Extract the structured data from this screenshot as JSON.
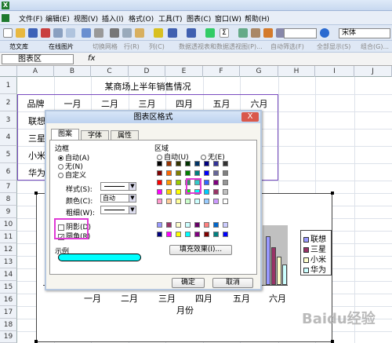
{
  "menubar": {
    "items": [
      "文件(F)",
      "编辑(E)",
      "视图(V)",
      "插入(I)",
      "格式(O)",
      "工具(T)",
      "图表(C)",
      "窗口(W)",
      "帮助(H)"
    ]
  },
  "toolbar": {
    "font_name": "宋体",
    "row2_items": [
      "范文库",
      "在线图片",
      "切换网格",
      "行(R)",
      "列(C)",
      "数据透视表和数据透视图(P)...",
      "自动筛选(F)",
      "全部显示(S)",
      "组合(G)..."
    ]
  },
  "formulabar": {
    "name_box": "图表区",
    "fx": "fx"
  },
  "columns": [
    "A",
    "B",
    "C",
    "D",
    "E",
    "F",
    "G",
    "H",
    "I",
    "J"
  ],
  "rows": [
    "1",
    "2",
    "3",
    "4",
    "5",
    "6",
    "7",
    "8",
    "9",
    "10",
    "11",
    "12",
    "13",
    "14",
    "15",
    "16",
    "17",
    "18",
    "19"
  ],
  "sheet": {
    "title": "某商场上半年销售情况",
    "header_row": [
      "品牌",
      "一月",
      "二月",
      "三月",
      "四月",
      "五月",
      "六月"
    ],
    "brands": [
      "联想",
      "三星",
      "小米",
      "华为"
    ]
  },
  "chart": {
    "x_labels": [
      "一月",
      "二月",
      "三月",
      "四月",
      "五月",
      "六月"
    ],
    "x_title": "月份",
    "legend": [
      "联想",
      "三星",
      "小米",
      "华为"
    ],
    "colors": [
      "#9999ff",
      "#993366",
      "#ffffcc",
      "#ccffff"
    ]
  },
  "chart_data": {
    "type": "bar",
    "categories": [
      "一月",
      "二月",
      "三月",
      "四月",
      "五月",
      "六月"
    ],
    "series": [
      {
        "name": "联想",
        "values": []
      },
      {
        "name": "三星",
        "values": []
      },
      {
        "name": "小米",
        "values": []
      },
      {
        "name": "华为",
        "values": []
      }
    ],
    "title": "",
    "xlabel": "月份",
    "ylabel": "",
    "legend_position": "right"
  },
  "dialog": {
    "title": "图表区格式",
    "close": "X",
    "tabs": [
      "图案",
      "字体",
      "属性"
    ],
    "border": {
      "group_label": "边框",
      "options": [
        "自动(A)",
        "无(N)",
        "自定义"
      ],
      "style_label": "样式(S):",
      "color_label": "颜色(C):",
      "color_value": "自动",
      "weight_label": "粗细(W):",
      "shadow_label": "阴影(D)",
      "round_label": "圆角(R)",
      "sample_label": "示例"
    },
    "area": {
      "group_label": "区域",
      "auto_option": "自动(U)",
      "none_option": "无(E)",
      "fill_effects": "填充效果(I)..."
    },
    "ok": "确定",
    "cancel": "取消",
    "palette": [
      "#000000",
      "#993300",
      "#333300",
      "#003300",
      "#003366",
      "#000080",
      "#333399",
      "#333333",
      "#800000",
      "#ff6600",
      "#808000",
      "#008000",
      "#008080",
      "#0000ff",
      "#666699",
      "#808080",
      "#ff0000",
      "#ff9900",
      "#99cc00",
      "#339966",
      "#33cccc",
      "#3366ff",
      "#800080",
      "#969696",
      "#ff00ff",
      "#ffcc00",
      "#ffff00",
      "#00ff00",
      "#00ffff",
      "#00ccff",
      "#993366",
      "#c0c0c0",
      "#ff99cc",
      "#ffcc99",
      "#ffff99",
      "#ccffcc",
      "#ccffff",
      "#99ccff",
      "#cc99ff",
      "#ffffff"
    ],
    "palette2": [
      "#9999ff",
      "#993366",
      "#ffffcc",
      "#ccffff",
      "#660066",
      "#ff8080",
      "#0066cc",
      "#ccccff",
      "#000080",
      "#ff00ff",
      "#ffff00",
      "#00ffff",
      "#800080",
      "#800000",
      "#008080",
      "#0000ff"
    ],
    "sample_color": "#00ffff"
  },
  "watermark": "Baidu经验"
}
